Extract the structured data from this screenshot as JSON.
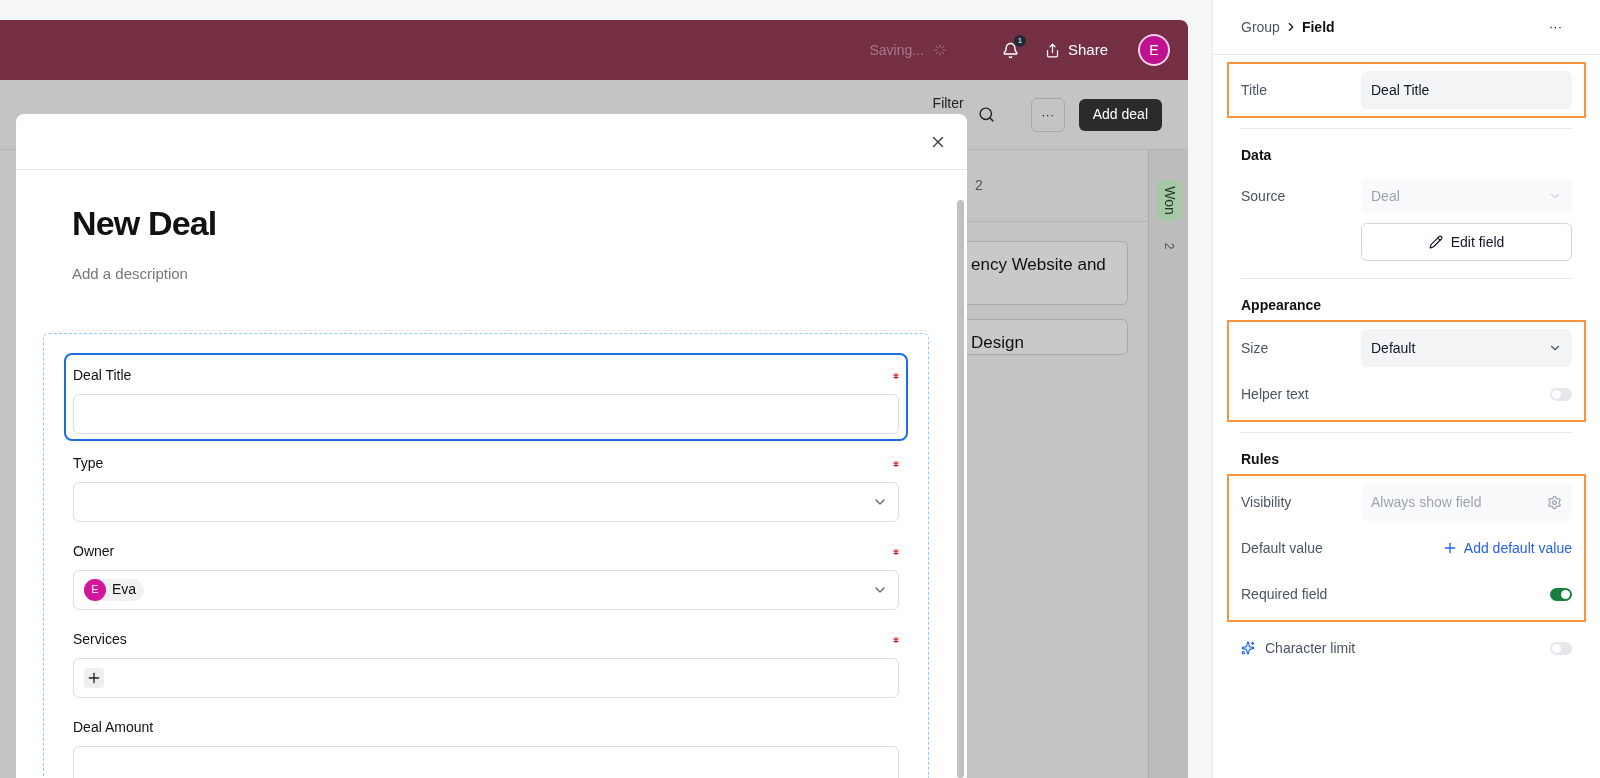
{
  "header": {
    "status": "Saving...",
    "notifications": "1",
    "share": "Share",
    "avatar": "E"
  },
  "toolbar": {
    "filter": "Filter",
    "more": "···",
    "add": "Add deal"
  },
  "board": {
    "column_count": "2",
    "cards": [
      "ency Website and",
      "Design"
    ],
    "next_column": {
      "tag": "Won",
      "count": "2"
    }
  },
  "modal": {
    "title": "New Deal",
    "description_placeholder": "Add a description",
    "fields": [
      {
        "label": "Deal Title",
        "kind": "text",
        "required": true,
        "selected": true
      },
      {
        "label": "Type",
        "kind": "select",
        "required": true,
        "selected": false
      },
      {
        "label": "Owner",
        "kind": "select",
        "required": true,
        "selected": false,
        "chips": [
          {
            "initial": "E",
            "name": "Eva"
          }
        ]
      },
      {
        "label": "Services",
        "kind": "multi",
        "required": true,
        "selected": false
      },
      {
        "label": "Deal Amount",
        "kind": "text",
        "required": false,
        "selected": false
      }
    ]
  },
  "panel": {
    "breadcrumb": {
      "parent": "Group",
      "current": "Field"
    },
    "more": "···",
    "sections": [
      {
        "blocks": [
          {
            "highlighted": true,
            "rows": [
              {
                "kind": "input",
                "label": "Title",
                "value": "Deal Title"
              }
            ]
          }
        ]
      },
      {
        "title": "Data",
        "blocks": [
          {
            "highlighted": false,
            "rows": [
              {
                "kind": "select",
                "label": "Source",
                "value": "Deal",
                "disabled": true
              },
              {
                "kind": "button",
                "text": "Edit field"
              }
            ]
          }
        ]
      },
      {
        "title": "Appearance",
        "blocks": [
          {
            "highlighted": true,
            "rows": [
              {
                "kind": "select",
                "label": "Size",
                "value": "Default",
                "disabled": false
              },
              {
                "kind": "toggle",
                "label": "Helper text",
                "on": false
              }
            ]
          }
        ]
      },
      {
        "title": "Rules",
        "blocks": [
          {
            "highlighted": true,
            "rows": [
              {
                "kind": "setting",
                "label": "Visibility",
                "value": "Always show field"
              },
              {
                "kind": "link",
                "label": "Default value",
                "text": "Add default value"
              },
              {
                "kind": "toggle",
                "label": "Required field",
                "on": true
              }
            ]
          },
          {
            "highlighted": false,
            "rows": [
              {
                "kind": "toggle",
                "label": "Character limit",
                "on": false,
                "sparkle": true
              }
            ]
          }
        ]
      }
    ]
  }
}
